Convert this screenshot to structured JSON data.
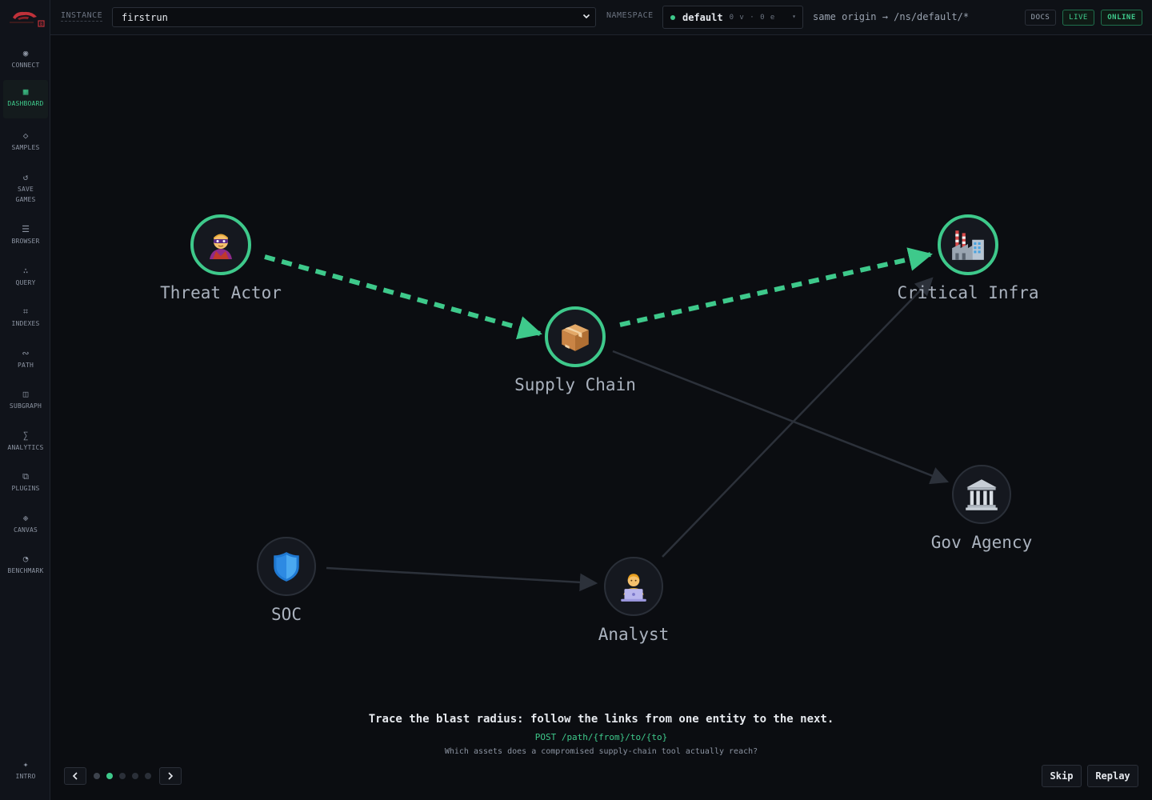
{
  "sidebar": {
    "items": [
      {
        "label": "CONNECT",
        "icon": "◉",
        "active": false
      },
      {
        "label": "DASHBOARD",
        "icon": "▦",
        "active": true
      },
      {
        "label": "SAMPLES",
        "icon": "◇",
        "active": false
      },
      {
        "label": "SAVE GAMES",
        "icon": "↺",
        "active": false
      },
      {
        "label": "BROWSER",
        "icon": "☰",
        "active": false
      },
      {
        "label": "QUERY",
        "icon": "∴",
        "active": false
      },
      {
        "label": "INDEXES",
        "icon": "⌗",
        "active": false
      },
      {
        "label": "PATH",
        "icon": "∾",
        "active": false
      },
      {
        "label": "SUBGRAPH",
        "icon": "◫",
        "active": false
      },
      {
        "label": "ANALYTICS",
        "icon": "∑",
        "active": false
      },
      {
        "label": "PLUGINS",
        "icon": "⧉",
        "active": false
      },
      {
        "label": "CANVAS",
        "icon": "❉",
        "active": false
      },
      {
        "label": "BENCHMARK",
        "icon": "◔",
        "active": false
      }
    ],
    "intro": {
      "label": "INTRO",
      "icon": "✦"
    }
  },
  "topbar": {
    "instance_label": "INSTANCE",
    "instance_value": "firstrun",
    "namespace_label": "NAMESPACE",
    "namespace_name": "default",
    "namespace_counts": "0 v · 0 e",
    "route": "same origin → /ns/default/*",
    "docs": "DOCS",
    "live": "LIVE",
    "online": "ONLINE"
  },
  "graph": {
    "nodes": [
      {
        "id": "threat",
        "label": "Threat Actor",
        "icon": "supervillain-icon",
        "highlight": true
      },
      {
        "id": "supply",
        "label": "Supply Chain",
        "icon": "package-icon",
        "highlight": true
      },
      {
        "id": "infra",
        "label": "Critical Infra",
        "icon": "factory-icon",
        "highlight": true
      },
      {
        "id": "gov",
        "label": "Gov Agency",
        "icon": "classical-building-icon",
        "highlight": false
      },
      {
        "id": "soc",
        "label": "SOC",
        "icon": "shield-icon",
        "highlight": false
      },
      {
        "id": "analyst",
        "label": "Analyst",
        "icon": "technologist-icon",
        "highlight": false
      }
    ],
    "edges": [
      {
        "from": "threat",
        "to": "supply",
        "highlight": true
      },
      {
        "from": "supply",
        "to": "infra",
        "highlight": true
      },
      {
        "from": "supply",
        "to": "gov",
        "highlight": false
      },
      {
        "from": "soc",
        "to": "analyst",
        "highlight": false
      },
      {
        "from": "analyst",
        "to": "infra",
        "highlight": false
      }
    ],
    "highlight_color": "#3ec98b",
    "dim_color": "#2c313a"
  },
  "tour": {
    "title": "Trace the blast radius: follow the links from one entity to the next.",
    "endpoint": "POST /path/{from}/to/{to}",
    "question": "Which assets does a compromised supply-chain tool actually reach?",
    "step": 2,
    "total_steps": 5,
    "skip": "Skip",
    "replay": "Replay"
  },
  "colors": {
    "accent": "#3ec98b",
    "background": "#0b0d11"
  }
}
